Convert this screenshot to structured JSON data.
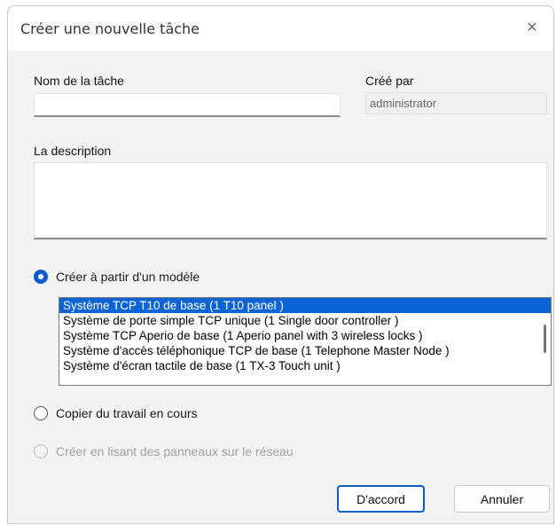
{
  "dialog": {
    "title": "Créer une nouvelle tâche",
    "close_icon": "×"
  },
  "fields": {
    "task_name_label": "Nom de la tâche",
    "task_name_value": "",
    "created_by_label": "Créé par",
    "created_by_value": "administrator",
    "description_label": "La description",
    "description_value": ""
  },
  "options": {
    "from_template_label": "Créer à partir d'un modèle",
    "copy_current_label": "Copier du travail en cours",
    "scan_network_label": "Créer en lisant des panneaux sur le réseau"
  },
  "templates": [
    "Système TCP T10 de base (1 T10 panel )",
    "Système de porte simple TCP unique (1 Single door controller )",
    "Système TCP Aperio de base (1 Aperio panel with 3 wireless locks )",
    "Système d'accès téléphonique TCP de base (1 Telephone Master Node )",
    "Système d'écran tactile de base (1 TX-3 Touch unit )"
  ],
  "buttons": {
    "ok_label": "D'accord",
    "cancel_label": "Annuler"
  },
  "colors": {
    "accent": "#0a5bcc",
    "selection": "#0a64d6"
  }
}
